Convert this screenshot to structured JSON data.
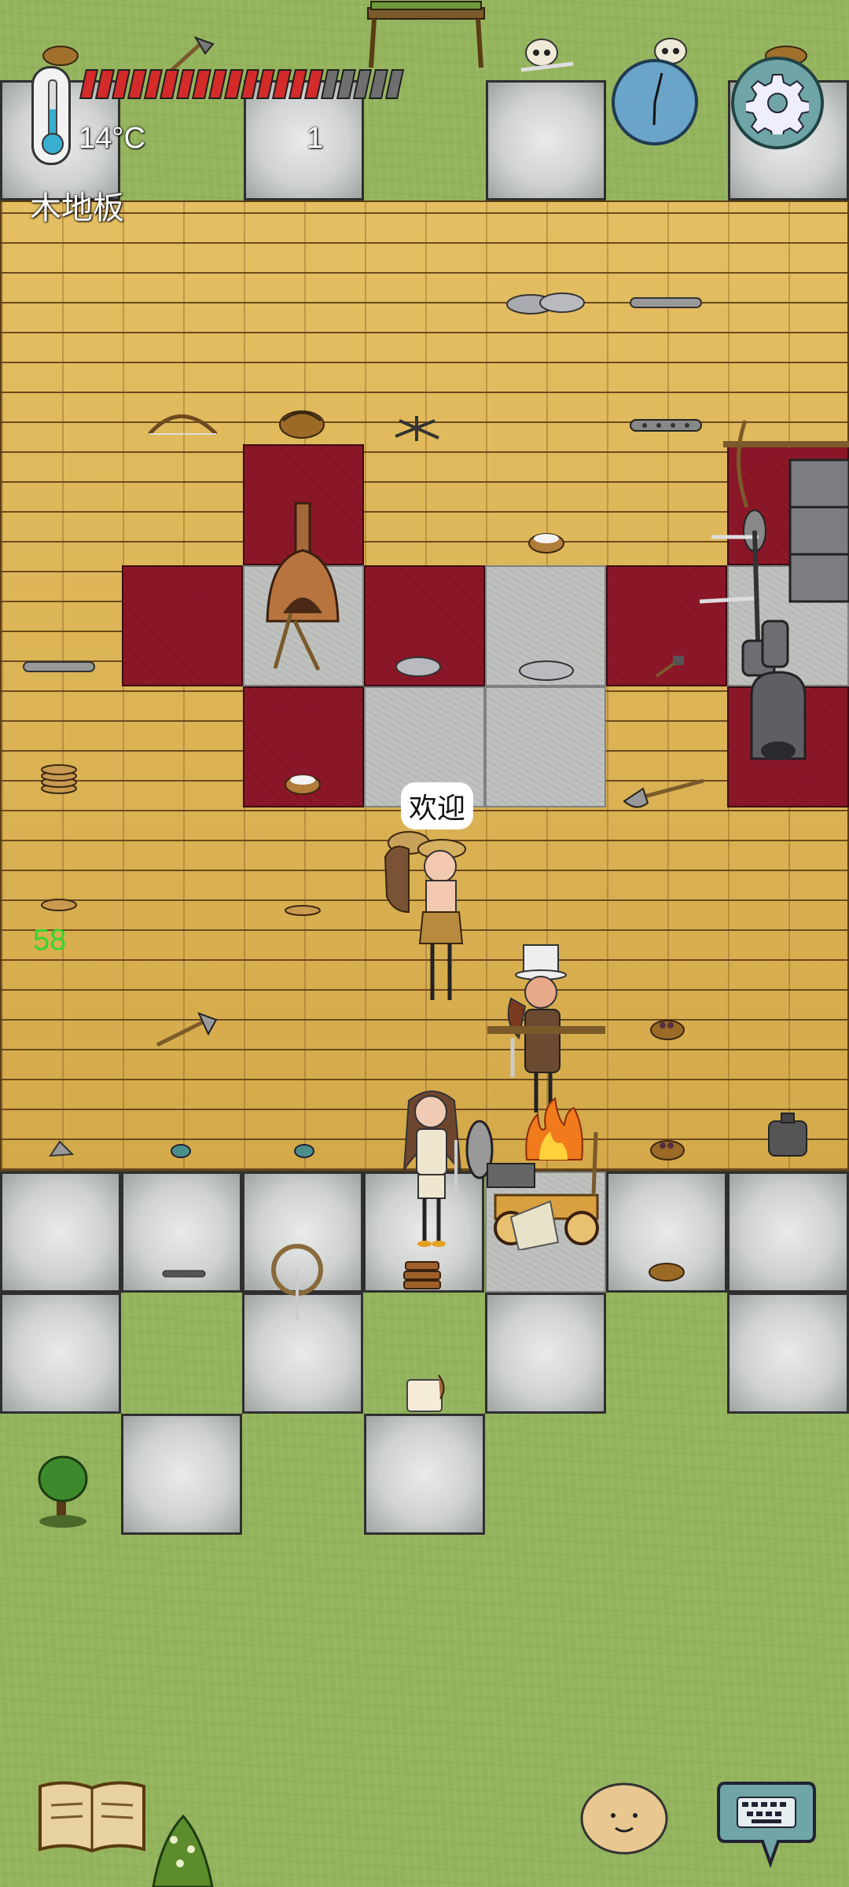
{
  "hud": {
    "temperature": "14°C",
    "counter": "1",
    "tile_name": "木地板",
    "health_segments_total": 20,
    "health_segments_filled": 15,
    "health_color": "#d42a2a",
    "health_empty_color": "#6f6f6f",
    "icons": [
      "thermometer-icon",
      "clock-icon",
      "gear-icon",
      "journal-icon",
      "emote-icon",
      "keyboard-icon"
    ]
  },
  "world": {
    "speech_bubble": "欢迎",
    "food_value": "58",
    "food_value_color": "#35d62c"
  }
}
